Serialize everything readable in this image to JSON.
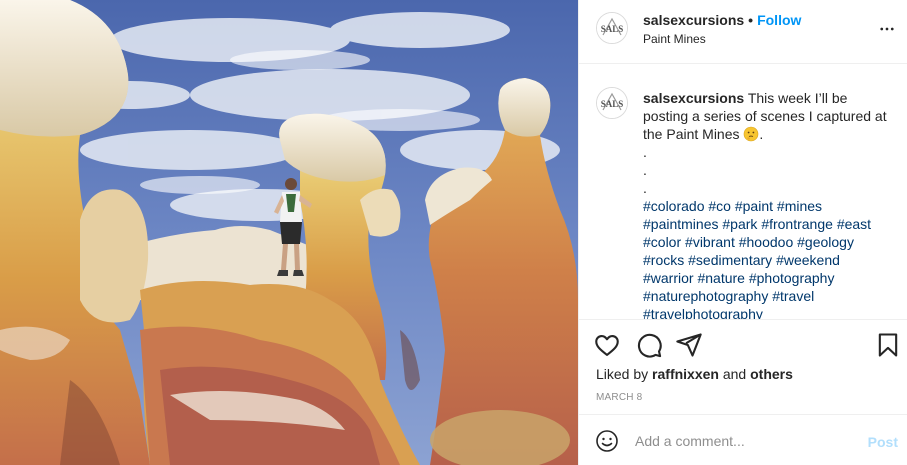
{
  "post": {
    "photo": {
      "description_icon": "photo-hoodoo-rock-formations",
      "sky_color": "#5872b8",
      "rock_colors": [
        "#e9c161",
        "#d8a24a",
        "#c7754e",
        "#efe6d2"
      ]
    },
    "header": {
      "avatar_text": "SALS",
      "username": "salsexcursions",
      "separator": "•",
      "follow_label": "Follow",
      "location": "Paint Mines",
      "more_icon": "more-horizontal-icon"
    },
    "caption": {
      "avatar_text": "SALS",
      "username": "salsexcursions",
      "text": "This week I’ll be posting a series of scenes I captured at the Paint Mines",
      "emoji_icon": "thinking-face-emoji",
      "dots": ".\n.\n.",
      "hashtags": [
        "#colorado",
        "#co",
        "#paint",
        "#mines",
        "#paintmines",
        "#park",
        "#frontrange",
        "#east",
        "#color",
        "#vibrant",
        "#hoodoo",
        "#geology",
        "#rocks",
        "#sedimentary",
        "#weekend",
        "#warrior",
        "#nature",
        "#photography",
        "#naturephotography",
        "#travel",
        "#travelphotography"
      ]
    },
    "actions": {
      "like_icon": "heart-icon",
      "comment_icon": "comment-icon",
      "share_icon": "paper-plane-icon",
      "save_icon": "bookmark-icon"
    },
    "likes": {
      "prefix": "Liked by",
      "user": "raffnixxen",
      "conjunction": "and",
      "others": "others"
    },
    "date": "MARCH 8",
    "add_comment": {
      "emoji_icon": "smiley-icon",
      "placeholder": "Add a comment...",
      "post_label": "Post",
      "post_color": "#b2dffc"
    },
    "colors": {
      "link_blue": "#0095f6",
      "hashtag": "#00376b",
      "border": "#efefef",
      "muted": "#8e8e8e"
    }
  }
}
